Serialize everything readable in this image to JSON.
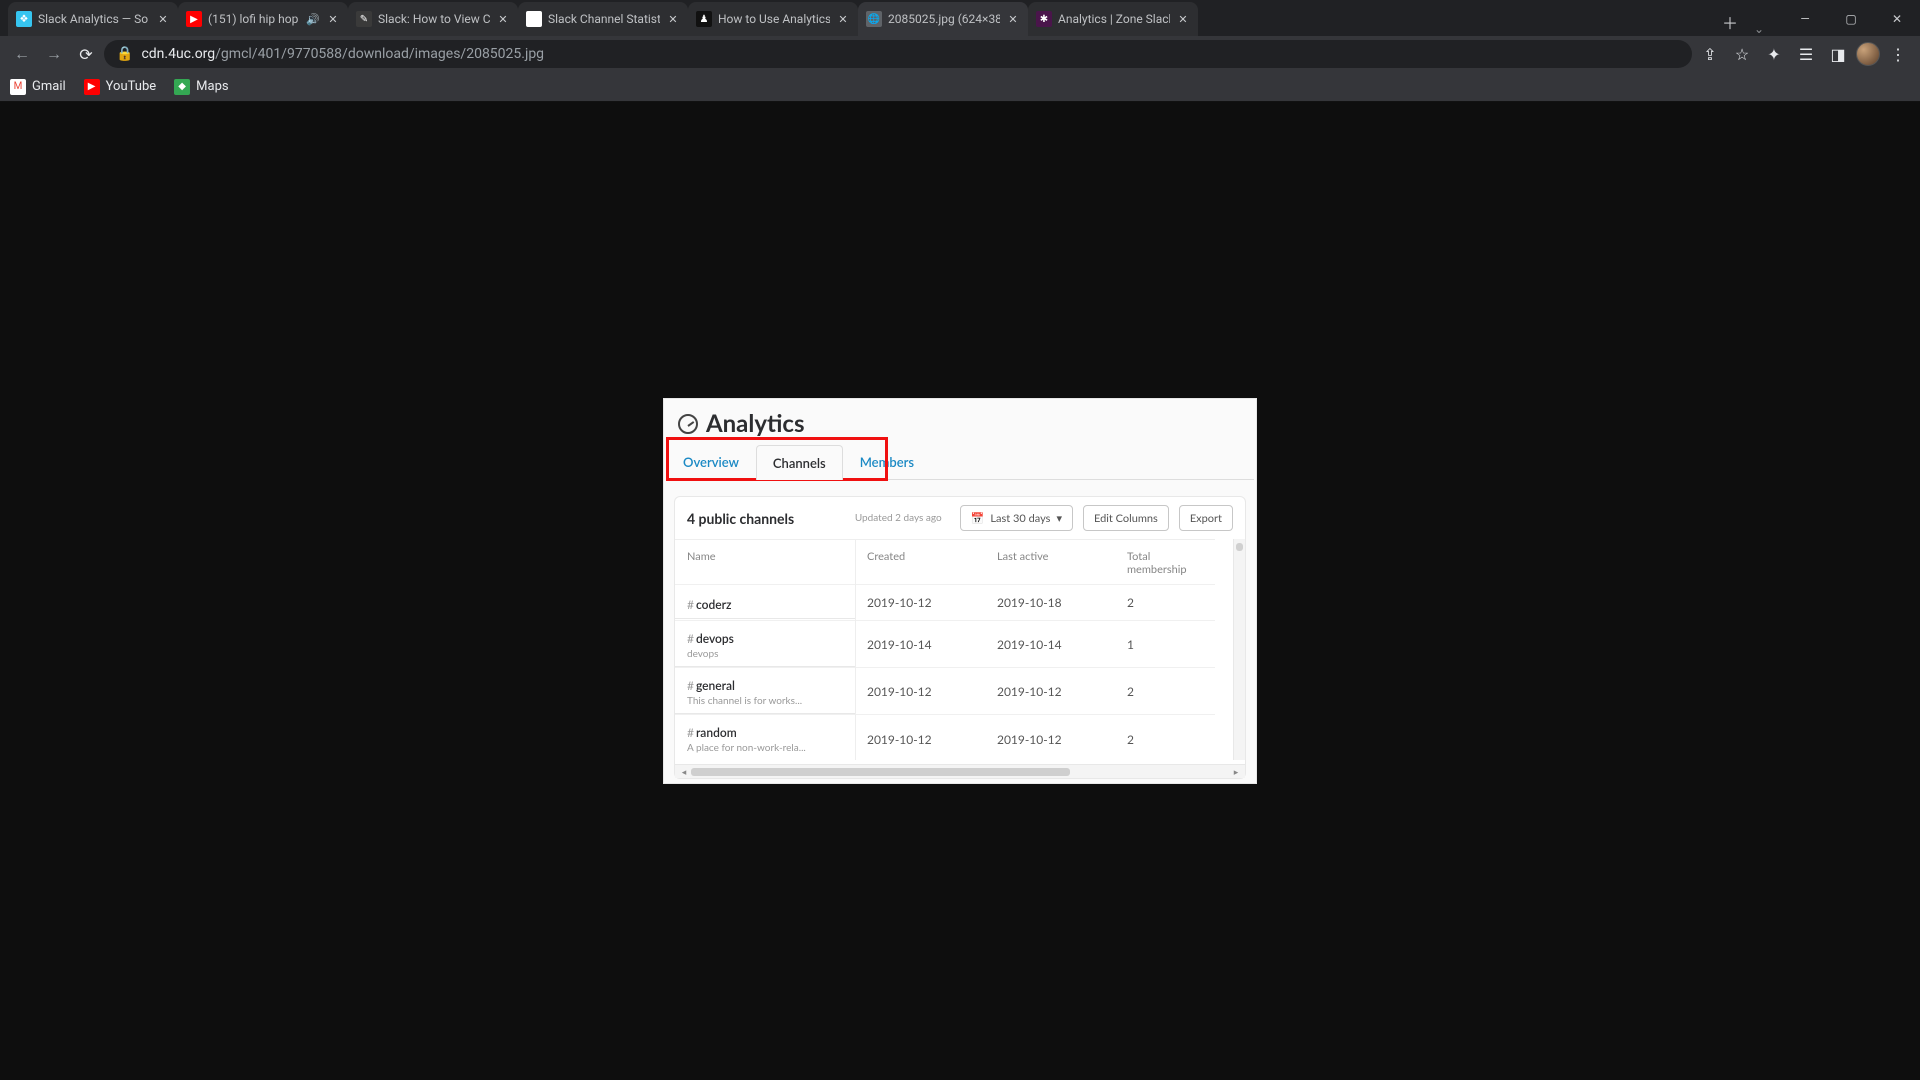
{
  "browser": {
    "tabs": [
      {
        "title": "Slack Analytics — So",
        "fav_bg": "#36c5f0",
        "fav_glyph": "❖",
        "audio": false
      },
      {
        "title": "(151) lofi hip hop",
        "fav_bg": "#ff0000",
        "fav_glyph": "▶",
        "audio": true
      },
      {
        "title": "Slack: How to View C",
        "fav_bg": "#3a3a3a",
        "fav_glyph": "✎",
        "audio": false
      },
      {
        "title": "Slack Channel Statisti",
        "fav_bg": "#ffffff",
        "fav_glyph": "◧",
        "audio": false
      },
      {
        "title": "How to Use Analytics",
        "fav_bg": "#111111",
        "fav_glyph": "♟",
        "audio": false
      },
      {
        "title": "2085025.jpg (624×38",
        "fav_bg": "#5f6368",
        "fav_glyph": "🌐",
        "audio": false,
        "active": true
      },
      {
        "title": "Analytics | Zone Slack",
        "fav_bg": "#4a154b",
        "fav_glyph": "✱",
        "audio": false
      }
    ],
    "url_domain": "cdn.4uc.org",
    "url_path": "/gmcl/401/9770588/download/images/2085025.jpg",
    "bookmarks": [
      {
        "label": "Gmail",
        "fav_bg": "#ffffff",
        "fav_glyph": "M",
        "fav_color": "#ea4335"
      },
      {
        "label": "YouTube",
        "fav_bg": "#ff0000",
        "fav_glyph": "▶",
        "fav_color": "#ffffff"
      },
      {
        "label": "Maps",
        "fav_bg": "#34a853",
        "fav_glyph": "◆",
        "fav_color": "#ffffff"
      }
    ]
  },
  "slack": {
    "page_title": "Analytics",
    "tabs": {
      "overview": "Overview",
      "channels": "Channels",
      "members": "Members"
    },
    "channel_count_label": "4 public channels",
    "updated_label": "Updated 2 days ago",
    "range_label": "Last 30 days",
    "edit_columns_label": "Edit Columns",
    "export_label": "Export",
    "columns": {
      "name": "Name",
      "created": "Created",
      "last_active": "Last active",
      "total": "Total membership"
    },
    "rows": [
      {
        "name": "coderz",
        "desc": "",
        "created": "2019-10-12",
        "last_active": "2019-10-18",
        "total": "2"
      },
      {
        "name": "devops",
        "desc": "devops",
        "created": "2019-10-14",
        "last_active": "2019-10-14",
        "total": "1"
      },
      {
        "name": "general",
        "desc": "This channel is for works...",
        "created": "2019-10-12",
        "last_active": "2019-10-12",
        "total": "2"
      },
      {
        "name": "random",
        "desc": "A place for non-work-rela...",
        "created": "2019-10-12",
        "last_active": "2019-10-12",
        "total": "2"
      }
    ]
  }
}
